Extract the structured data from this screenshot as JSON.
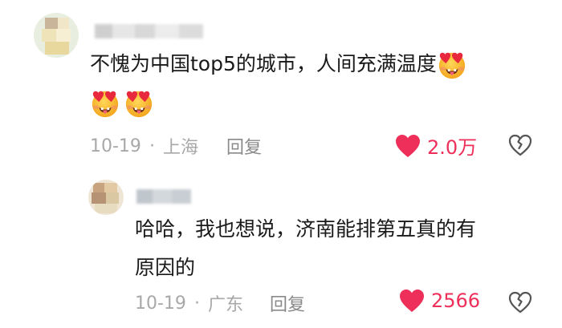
{
  "comments": [
    {
      "text": "不愧为中国top5的城市，人间充满温度",
      "date": "10-19",
      "location": "上海",
      "reply_label": "回复",
      "likes": "2.0万",
      "emoji": "smiling-face-with-heart-eyes-tongue"
    },
    {
      "text_line1": "哈哈，我也想说，济南能排第五真的有",
      "text_line2": "原因的",
      "date": "10-19",
      "location": "广东",
      "reply_label": "回复",
      "likes": "2566"
    }
  ],
  "colors": {
    "like": "#ee2f5a",
    "meta": "#a8a8a8"
  },
  "separator": "·"
}
